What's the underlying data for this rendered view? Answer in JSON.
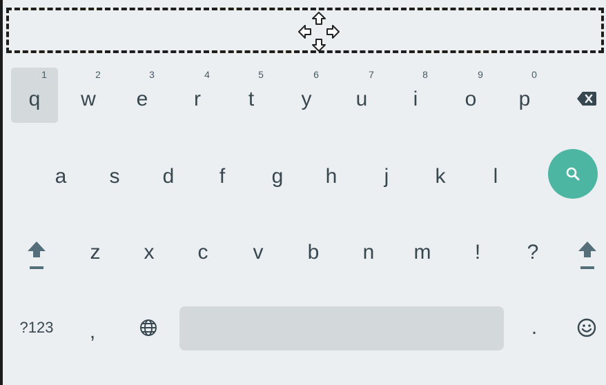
{
  "keyboard": {
    "row1": [
      {
        "label": "q",
        "hint": "1"
      },
      {
        "label": "w",
        "hint": "2"
      },
      {
        "label": "e",
        "hint": "3"
      },
      {
        "label": "r",
        "hint": "4"
      },
      {
        "label": "t",
        "hint": "5"
      },
      {
        "label": "y",
        "hint": "6"
      },
      {
        "label": "u",
        "hint": "7"
      },
      {
        "label": "i",
        "hint": "8"
      },
      {
        "label": "o",
        "hint": "9"
      },
      {
        "label": "p",
        "hint": "0"
      }
    ],
    "row2": [
      "a",
      "s",
      "d",
      "f",
      "g",
      "h",
      "j",
      "k",
      "l"
    ],
    "row3": [
      "z",
      "x",
      "c",
      "v",
      "b",
      "n",
      "m",
      "!",
      "?"
    ],
    "row4": {
      "symbols": "?123",
      "comma": ",",
      "period": "."
    },
    "icons": {
      "move": "move-arrows-icon",
      "backspace": "backspace-icon",
      "search": "search-icon",
      "shift": "shift-icon",
      "globe": "globe-icon",
      "emoji": "emoji-icon"
    },
    "colors": {
      "background": "#eceff1",
      "key_text": "#37474f",
      "search_accent": "#4db6a3",
      "drag_border_yellow": "#f2c230",
      "drag_border_dark": "#1e1e1e"
    }
  }
}
